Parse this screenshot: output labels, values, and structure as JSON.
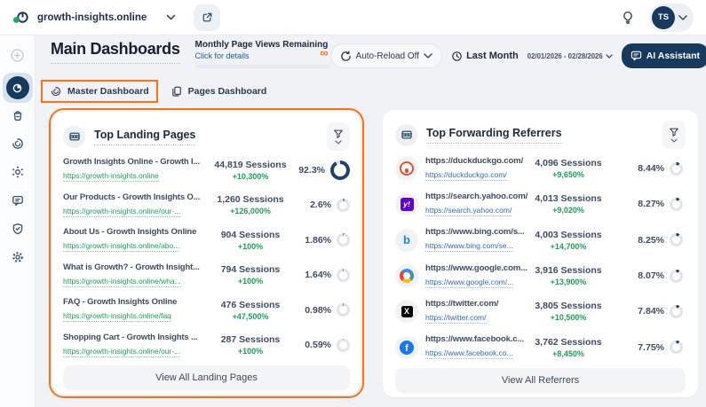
{
  "topbar": {
    "site_name": "growth-insights.online",
    "avatar_initials": "TS"
  },
  "header": {
    "title": "Main Dashboards",
    "quota_label": "Monthly Page Views Remaining",
    "quota_link": "Click for details",
    "quota_symbol": "∞",
    "auto_reload": "Auto-Reload Off",
    "period_label": "Last Month",
    "date_range": "02/01/2026 - 02/28/2026",
    "ai_button": "AI Assistant"
  },
  "tabs": {
    "master": "Master Dashboard",
    "pages": "Pages Dashboard"
  },
  "sidebar": {
    "items": [
      "add-dashboard-icon",
      "pie-chart-icon",
      "shopping-bag-icon",
      "gauge-icon",
      "automation-icon",
      "chat-icon",
      "shield-check-icon",
      "gear-icon"
    ]
  },
  "landing": {
    "title": "Top Landing Pages",
    "view_all": "View All Landing Pages",
    "rows": [
      {
        "title": "Growth Insights Online - Growth I...",
        "url": "https://growth-insights.online",
        "sessions": "44,819 Sessions",
        "change": "+10,300%",
        "percent": "92.3%",
        "pct": 92.3
      },
      {
        "title": "Our Products - Growth Insights O...",
        "url": "https://growth-insights.online/our-...",
        "sessions": "1,260 Sessions",
        "change": "+126,000%",
        "percent": "2.6%",
        "pct": 2.6
      },
      {
        "title": "About Us - Growth Insights Online",
        "url": "https://growth-insights.online/abo...",
        "sessions": "904 Sessions",
        "change": "+100%",
        "percent": "1.86%",
        "pct": 1.86
      },
      {
        "title": "What is Growth? - Growth Insight...",
        "url": "https://growth-insights.online/wha...",
        "sessions": "794 Sessions",
        "change": "+100%",
        "percent": "1.64%",
        "pct": 1.64
      },
      {
        "title": "FAQ - Growth Insights Online",
        "url": "https://growth-insights.online/faq",
        "sessions": "476 Sessions",
        "change": "+47,500%",
        "percent": "0.98%",
        "pct": 0.98
      },
      {
        "title": "Shopping Cart - Growth Insights ...",
        "url": "https://growth-insights.online/our-...",
        "sessions": "287 Sessions",
        "change": "+100%",
        "percent": "0.59%",
        "pct": 0.59
      }
    ]
  },
  "referrers": {
    "title": "Top Forwarding Referrers",
    "view_all": "View All Referrers",
    "rows": [
      {
        "icon": "duckduckgo",
        "title": "https://duckduckgo.com/",
        "url": "https://duckduckgo.com/",
        "sessions": "4,096 Sessions",
        "change": "+9,650%",
        "percent": "8.44%",
        "pct": 8.44
      },
      {
        "icon": "yahoo",
        "title": "https://search.yahoo.com/",
        "url": "https://search.yahoo.com/",
        "sessions": "4,013 Sessions",
        "change": "+9,020%",
        "percent": "8.27%",
        "pct": 8.27
      },
      {
        "icon": "bing",
        "title": "https://www.bing.com/s...",
        "url": "https://www.bing.com/se...",
        "sessions": "4,003 Sessions",
        "change": "+14,700%",
        "percent": "8.25%",
        "pct": 8.25
      },
      {
        "icon": "google",
        "title": "https://www.google.com...",
        "url": "https://www.google.com/...",
        "sessions": "3,916 Sessions",
        "change": "+13,900%",
        "percent": "8.07%",
        "pct": 8.07
      },
      {
        "icon": "twitter",
        "title": "https://twitter.com/",
        "url": "https://twitter.com/",
        "sessions": "3,805 Sessions",
        "change": "+10,500%",
        "percent": "7.84%",
        "pct": 7.84
      },
      {
        "icon": "facebook",
        "title": "https://www.facebook.c...",
        "url": "https://www.facebook.co...",
        "sessions": "3,762 Sessions",
        "change": "+8,450%",
        "percent": "7.75%",
        "pct": 7.75
      }
    ]
  },
  "colors": {
    "navy": "#17395e",
    "green": "#1a9e57",
    "orange": "#f97316",
    "link_blue": "#2e6bb4"
  }
}
